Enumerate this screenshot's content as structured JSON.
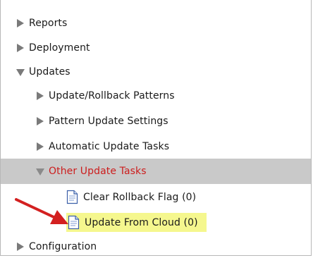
{
  "nav": {
    "reports": "Reports",
    "deployment": "Deployment",
    "updates": "Updates",
    "update_rollback_patterns": "Update/Rollback Patterns",
    "pattern_update_settings": "Pattern Update Settings",
    "automatic_update_tasks": "Automatic Update Tasks",
    "other_update_tasks": "Other Update Tasks",
    "clear_rollback_flag": "Clear Rollback Flag (0)",
    "update_from_cloud": "Update From Cloud (0)",
    "configuration": "Configuration"
  },
  "colors": {
    "selected_text": "#cc1d1d",
    "selected_background": "#c9c9c9",
    "highlight_background": "#f5f78e",
    "arrow": "#d32020"
  },
  "icons": {
    "collapsed": "triangle-right-icon",
    "expanded": "triangle-down-icon",
    "document": "document-icon",
    "annotation_arrow": "red-arrow-icon"
  }
}
